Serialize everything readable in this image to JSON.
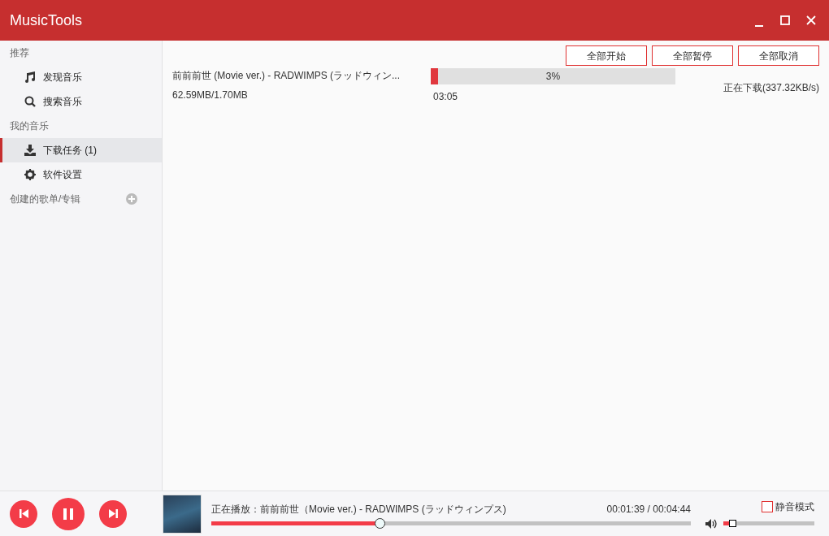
{
  "window": {
    "title": "MusicTools"
  },
  "sidebar": {
    "sections": [
      {
        "title": "推荐",
        "items": [
          {
            "kind": "music",
            "label": "发现音乐",
            "selected": false
          },
          {
            "kind": "search",
            "label": "搜索音乐",
            "selected": false
          }
        ]
      },
      {
        "title": "我的音乐",
        "items": [
          {
            "kind": "download",
            "label": "下载任务 (1)",
            "selected": true
          },
          {
            "kind": "settings",
            "label": "软件设置",
            "selected": false
          }
        ]
      },
      {
        "title": "创建的歌单/专辑",
        "add": true
      }
    ]
  },
  "toolbar": {
    "buttons": [
      "全部开始",
      "全部暂停",
      "全部取消"
    ]
  },
  "downloads": [
    {
      "title": "前前前世 (Movie ver.) - RADWIMPS (ラッドウィン...",
      "size": "62.59MB/1.70MB",
      "level": 0.03,
      "percent": "3%",
      "time": "03:05",
      "status": "正在下载(337.32KB/s)"
    }
  ],
  "player": {
    "now_playing": "正在播放：前前前世（Movie ver.) - RADWIMPS (ラッドウィンプス)",
    "time": "00:01:39 / 00:04:44",
    "progress": {
      "level": 0.35
    },
    "mute": {
      "label": "静音模式",
      "checked": false
    },
    "volume": {
      "level": 0.08
    }
  }
}
